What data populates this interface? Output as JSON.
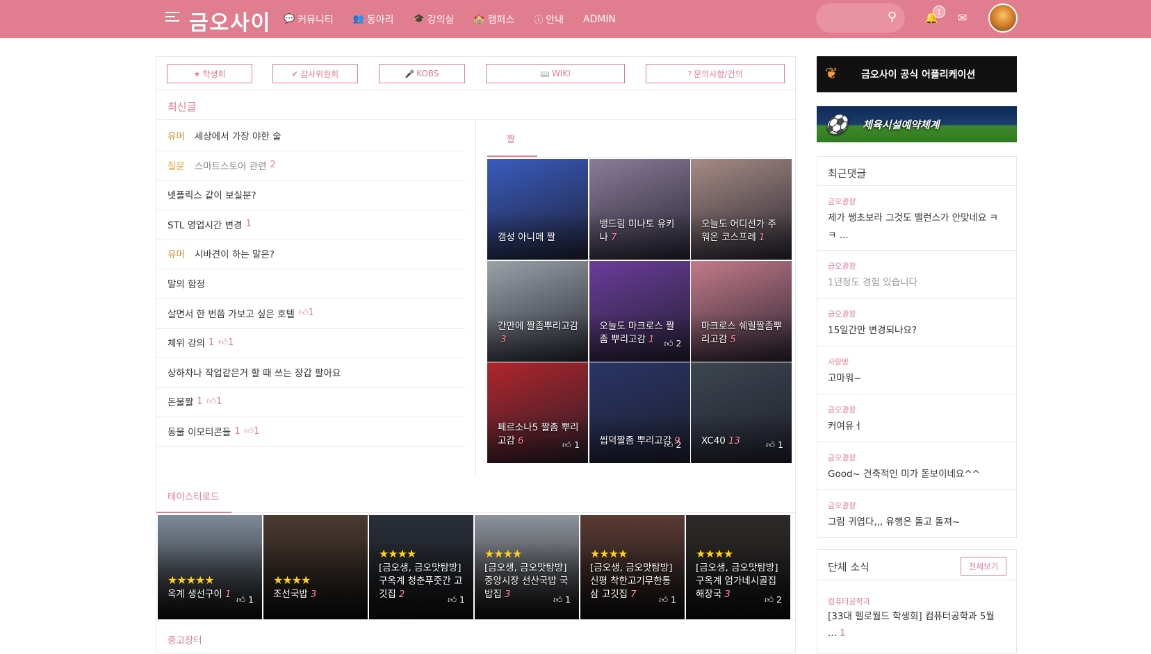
{
  "header": {
    "logo": "금오사이",
    "nav": [
      {
        "label": "커뮤니티",
        "icon": "comments-icon"
      },
      {
        "label": "동아리",
        "icon": "users-icon"
      },
      {
        "label": "강의실",
        "icon": "graduation-cap-icon"
      },
      {
        "label": "캠퍼스",
        "icon": "school-icon"
      },
      {
        "label": "안내",
        "icon": "info-icon"
      },
      {
        "label": "ADMIN",
        "icon": ""
      }
    ],
    "search_placeholder": "",
    "notification_count": "1"
  },
  "quick_links": [
    {
      "label": "학생회",
      "icon": "★"
    },
    {
      "label": "감사위원회",
      "icon": "✔"
    },
    {
      "label": "KOBS",
      "icon": "🎤"
    },
    {
      "label": "WIKI",
      "icon": "📖"
    },
    {
      "label": "문의사항/건의",
      "icon": "?"
    }
  ],
  "latest": {
    "title": "최신글",
    "posts": [
      {
        "category": "유머",
        "title": "세상에서 가장 야한 술",
        "comments": "",
        "likes": ""
      },
      {
        "category": "질문",
        "title": "스마트스토어 관련",
        "comments": "2",
        "likes": ""
      },
      {
        "category": "",
        "title": "넷플릭스 같이 보실분?",
        "comments": "",
        "likes": ""
      },
      {
        "category": "",
        "title": "STL 영업시간 변경",
        "comments": "1",
        "likes": ""
      },
      {
        "category": "유머",
        "title": "시바견이 하는 말은?",
        "comments": "",
        "likes": ""
      },
      {
        "category": "",
        "title": "말의 함정",
        "comments": "",
        "likes": ""
      },
      {
        "category": "",
        "title": "살면서 한 번쯤 가보고 싶은 호텔",
        "comments": "",
        "likes": "1"
      },
      {
        "category": "",
        "title": "체위 강의",
        "comments": "1",
        "likes": "1"
      },
      {
        "category": "",
        "title": "상하차나 작업같은거 할 때 쓰는 장갑 팔아요",
        "comments": "",
        "likes": ""
      },
      {
        "category": "",
        "title": "돈물짤",
        "comments": "1",
        "likes": "1"
      },
      {
        "category": "",
        "title": "동물 이모티콘들",
        "comments": "1",
        "likes": "1"
      }
    ]
  },
  "jjal": {
    "tab": "짤",
    "tiles": [
      {
        "title": "갬성 아니메 짤",
        "comments": "",
        "likes": "",
        "bg": "#3a5bbf"
      },
      {
        "title": "뱅드림 미나토 유키나",
        "comments": "7",
        "likes": "",
        "bg": "#8a7c9a"
      },
      {
        "title": "오늘도 어디선가 주워온 코스프레",
        "comments": "1",
        "likes": "",
        "bg": "#a78b86"
      },
      {
        "title": "간만에 짤좀뿌리고감",
        "comments": "3",
        "likes": "",
        "bg": "#9aa2a8"
      },
      {
        "title": "오늘도 마크로스 짤좀 뿌리고감",
        "comments": "1",
        "likes": "2",
        "bg": "#6b3c9a"
      },
      {
        "title": "마크로스 쉐릴짤좀뿌리고감",
        "comments": "5",
        "likes": "",
        "bg": "#c47a8a"
      },
      {
        "title": "페르소나5 짤좀 뿌리고감",
        "comments": "6",
        "likes": "1",
        "bg": "#b0262c"
      },
      {
        "title": "씹덕짤좀 뿌리고감",
        "comments": "9",
        "likes": "2",
        "bg": "#2a3566"
      },
      {
        "title": "XC40",
        "comments": "13",
        "likes": "1",
        "bg": "#3d4650"
      }
    ]
  },
  "tasteroad": {
    "title": "테이스티로드",
    "tiles": [
      {
        "stars": "★★★★★",
        "title": "옥계 생선구이",
        "comments": "1",
        "likes": "1",
        "bg": "#7e8a99"
      },
      {
        "stars": "★★★★",
        "title": "조선국밥",
        "comments": "3",
        "likes": "",
        "bg": "#4a3a30"
      },
      {
        "stars": "★★★★",
        "title": "[금오생, 금오맛탐방] 구옥계 청춘푸줏간 고깃집",
        "comments": "2",
        "likes": "1",
        "bg": "#2a2f3a"
      },
      {
        "stars": "★★★★",
        "title": "[금오생, 금오맛탐방] 중앙시장 선산국밥 국밥집",
        "comments": "3",
        "likes": "1",
        "bg": "#8e939c"
      },
      {
        "stars": "★★★★",
        "title": "[금오생, 금오맛탐방] 신평 착한고기무한통삼 고깃집",
        "comments": "7",
        "likes": "1",
        "bg": "#5a3a34"
      },
      {
        "stars": "★★★★",
        "title": "[금오생, 금오맛탐방] 구옥계 엄가네시골집 해장국",
        "comments": "3",
        "likes": "2",
        "bg": "#2f2a2a"
      }
    ]
  },
  "used_market": {
    "title": "중고장터"
  },
  "banners": {
    "app": "금오사이 공식 어플리케이션",
    "sports": "체육시설예약체계"
  },
  "recent_comments": {
    "title": "최근댓글",
    "items": [
      {
        "board": "금오광장",
        "text": "제가 쌩초보라 그것도 밸런스가 안맞네요 ㅋㅋ ...",
        "grey": false
      },
      {
        "board": "금오광장",
        "text": "1년정도 경험 있습니다",
        "grey": true
      },
      {
        "board": "금오광장",
        "text": "15일간만 변경되나요?",
        "grey": false
      },
      {
        "board": "사랑방",
        "text": "고마워~",
        "grey": false
      },
      {
        "board": "금오광장",
        "text": "커여유ㅓ",
        "grey": false
      },
      {
        "board": "금오광장",
        "text": "Good~ 건축적인 미가 돋보이네요^^",
        "grey": false
      },
      {
        "board": "금오광장",
        "text": "그림 귀엽다,,, 유행은 돌고 돌져~",
        "grey": false
      }
    ]
  },
  "group_news": {
    "title": "단체 소식",
    "view_all": "전체보기",
    "item": {
      "board": "컴퓨터공학과",
      "text": "[33대 헬로월드 학생회] 컴퓨터공학과 5월 ...",
      "comments": "1"
    }
  }
}
